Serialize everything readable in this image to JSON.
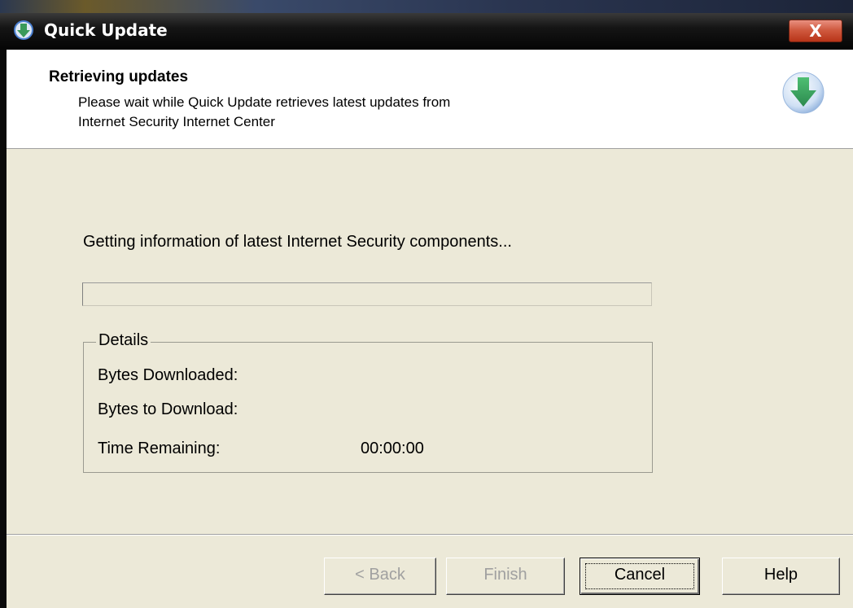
{
  "window": {
    "title": "Quick Update",
    "close_label": "X"
  },
  "header": {
    "title": "Retrieving updates",
    "subtitle_line1": "Please wait while Quick Update retrieves latest updates from",
    "subtitle_line2": "Internet Security Internet Center"
  },
  "main": {
    "status": "Getting information of latest Internet Security components...",
    "progress_fraction": 0
  },
  "details": {
    "legend": "Details",
    "bytes_downloaded_label": "Bytes Downloaded:",
    "bytes_to_download_label": "Bytes to Download:",
    "time_remaining_label": "Time Remaining:",
    "time_remaining_value": "00:00:00"
  },
  "buttons": {
    "back": "< Back",
    "finish": "Finish",
    "cancel": "Cancel",
    "help": "Help"
  },
  "colors": {
    "accent": "#3a9a5a",
    "title_bar": "#0a0a0a",
    "dialog_bg": "#ece9d8"
  },
  "icons": {
    "app": "download-arrow-icon",
    "header": "download-arrow-icon",
    "close": "close-icon"
  }
}
